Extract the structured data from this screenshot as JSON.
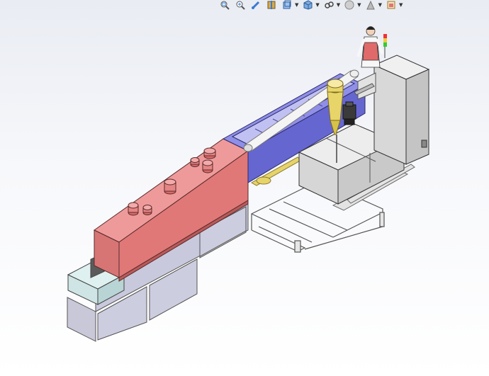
{
  "toolbar": {
    "items": [
      {
        "icon": "zoom-to-fit-icon"
      },
      {
        "icon": "zoom-to-area-icon"
      },
      {
        "icon": "previous-view-icon"
      },
      {
        "icon": "section-view-icon"
      },
      {
        "icon": "view-orientation-icon",
        "dropdown": true
      },
      {
        "icon": "display-style-icon",
        "dropdown": true
      },
      {
        "icon": "hide-show-items-icon",
        "dropdown": true
      },
      {
        "icon": "edit-appearance-icon",
        "dropdown": true
      },
      {
        "icon": "apply-scene-icon",
        "dropdown": true
      },
      {
        "icon": "view-settings-icon",
        "dropdown": true
      }
    ]
  },
  "colors": {
    "background_top": "#e9ecf3",
    "oven_red": "#e07575",
    "tunnel_blue": "#6b6bd6",
    "frame_grey": "#d9d9df",
    "cabinet_grey": "#dcdcdc"
  }
}
